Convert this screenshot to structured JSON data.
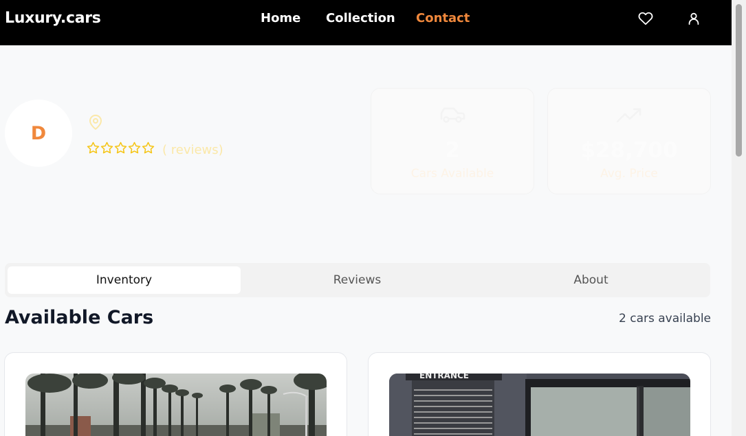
{
  "nav": {
    "logo": "Luxury.cars",
    "links": [
      "Home",
      "Collection",
      "Contact"
    ],
    "active_link": "Contact",
    "icons": [
      "heart-icon",
      "user-icon"
    ]
  },
  "profile": {
    "avatar_letter": "D",
    "location_icon": "map-pin-icon",
    "rating_stars": 5,
    "rating_value": 0,
    "reviews_text": "( reviews)"
  },
  "stats": [
    {
      "icon": "car-icon",
      "value": "2",
      "label": "Cars Available"
    },
    {
      "icon": "trending-up-icon",
      "value": "$28,700",
      "label": "Avg. Price"
    }
  ],
  "tabs": [
    "Inventory",
    "Reviews",
    "About"
  ],
  "active_tab": "Inventory",
  "inventory": {
    "title": "Available Cars",
    "count_text": "2 cars available"
  },
  "cars": [
    {
      "image": "palm-tree-street-photo"
    },
    {
      "image": "garage-entrance-photo",
      "sign_text": "ENTRANCE"
    }
  ],
  "colors": {
    "accent": "#f0883c",
    "navbar": "#000000",
    "background": "#f8f9fa",
    "star": "#f5c518"
  }
}
